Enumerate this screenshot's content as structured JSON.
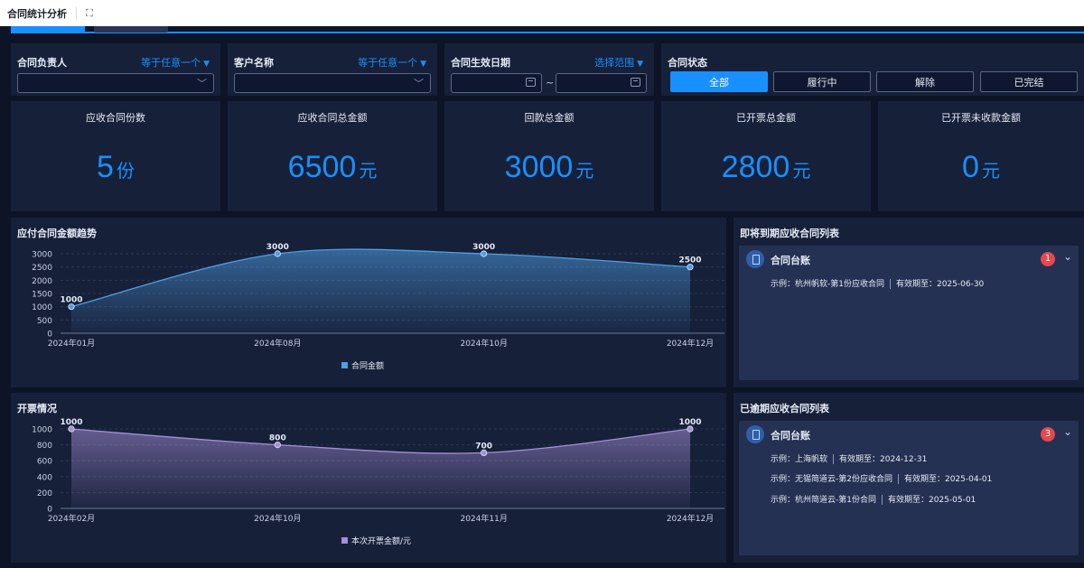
{
  "title": "合同统计分析",
  "filters": {
    "owner": {
      "label": "合同负责人",
      "mode": "等于任意一个",
      "value": ""
    },
    "customer": {
      "label": "客户名称",
      "mode": "等于任意一个",
      "value": ""
    },
    "date": {
      "label": "合同生效日期",
      "mode": "选择范围",
      "start": "",
      "end": "",
      "separator": "~"
    },
    "status": {
      "label": "合同状态",
      "options": [
        "全部",
        "履行中",
        "解除",
        "已完结"
      ],
      "selected": "全部"
    }
  },
  "kpis": [
    {
      "label": "应收合同份数",
      "value": "5",
      "unit": "份"
    },
    {
      "label": "应收合同总金额",
      "value": "6500",
      "unit": "元"
    },
    {
      "label": "回款总金额",
      "value": "3000",
      "unit": "元"
    },
    {
      "label": "已开票总金额",
      "value": "2800",
      "unit": "元"
    },
    {
      "label": "已开票未收款金额",
      "value": "0",
      "unit": "元"
    }
  ],
  "chart_data": [
    {
      "type": "area",
      "title": "应付合同金额趋势",
      "categories": [
        "2024年01月",
        "2024年08月",
        "2024年10月",
        "2024年12月"
      ],
      "series": [
        {
          "name": "合同金额",
          "values": [
            1000,
            3000,
            3000,
            2500
          ]
        }
      ],
      "ylim": [
        0,
        3000
      ],
      "yticks": [
        0,
        500,
        1000,
        1500,
        2000,
        2500,
        3000
      ],
      "legend": "bottom",
      "grid": true,
      "color": "#4e9fe6"
    },
    {
      "type": "area",
      "title": "开票情况",
      "categories": [
        "2024年02月",
        "2024年10月",
        "2024年11月",
        "2024年12月"
      ],
      "series": [
        {
          "name": "本次开票金额/元",
          "values": [
            1000,
            800,
            700,
            1000
          ]
        }
      ],
      "ylim": [
        0,
        1000
      ],
      "yticks": [
        0,
        200,
        400,
        600,
        800,
        1000
      ],
      "legend": "bottom",
      "grid": true,
      "color": "#a48fd8"
    }
  ],
  "lists": {
    "upcoming": {
      "title": "即将到期应收合同列表",
      "card_title": "合同台账",
      "count": "1",
      "items": [
        {
          "name": "示例：杭州帆软-第1份应收合同",
          "expiry": "有效期至：2025-06-30"
        }
      ]
    },
    "overdue": {
      "title": "已逾期应收合同列表",
      "card_title": "合同台账",
      "count": "3",
      "items": [
        {
          "name": "示例：上海帆软",
          "expiry": "有效期至：2024-12-31"
        },
        {
          "name": "示例：无锡简道云-第2份应收合同",
          "expiry": "有效期至：2025-04-01"
        },
        {
          "name": "示例：杭州简道云-第1份合同",
          "expiry": "有效期至：2025-05-01"
        }
      ]
    }
  }
}
